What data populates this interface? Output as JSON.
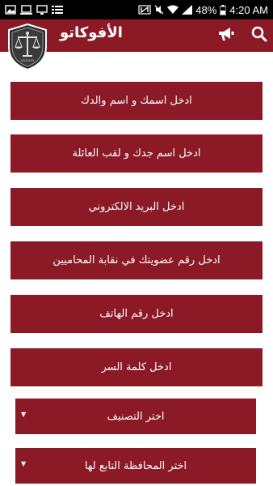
{
  "status_bar": {
    "battery": "48%",
    "time": "4:20 AM"
  },
  "header": {
    "title": "الأفوكاتو",
    "logo_text": "AVOCATO",
    "accent_color": "#8b1a26"
  },
  "form": {
    "fields": [
      {
        "placeholder": "ادخل اسمك و اسم والدك"
      },
      {
        "placeholder": "ادخل اسم جدك و لقب العائلة"
      },
      {
        "placeholder": "ادخل البريد الالكتروني"
      },
      {
        "placeholder": "ادخل رقم عضويتك في نقابة المحاميين"
      },
      {
        "placeholder": "ادخل رقم الهاتف"
      },
      {
        "placeholder": "ادخل كلمة السر"
      }
    ],
    "selects": [
      {
        "label": "اختر التصنيف"
      },
      {
        "label": "اختر المحافظة التابع لها"
      }
    ]
  }
}
